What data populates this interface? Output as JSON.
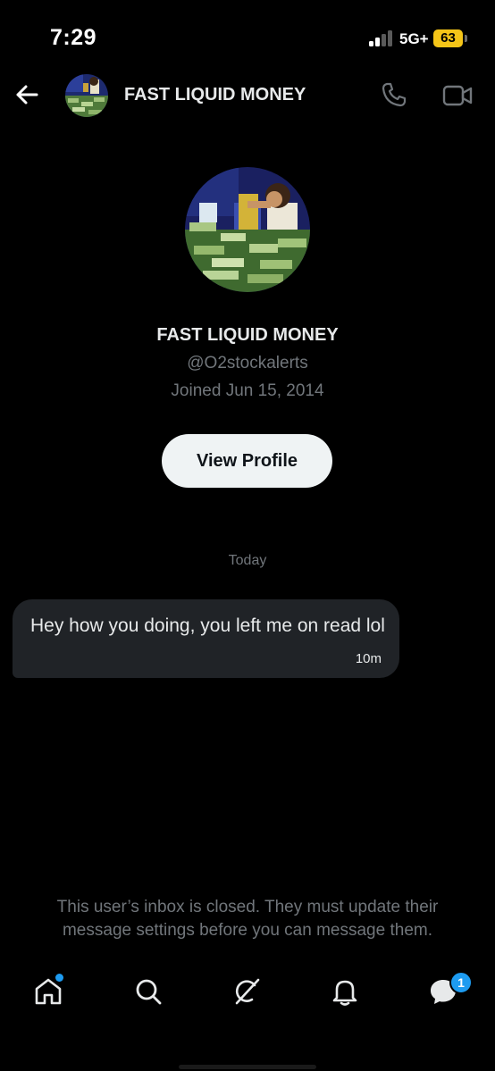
{
  "status": {
    "time": "7:29",
    "network": "5G+",
    "battery": "63"
  },
  "header": {
    "name": "FAST LIQUID MONEY",
    "back_icon": "arrow-left-icon",
    "call_icon": "phone-icon",
    "video_icon": "video-icon"
  },
  "profile": {
    "name": "FAST LIQUID MONEY",
    "handle": "@O2stockalerts",
    "joined": "Joined Jun 15, 2014",
    "view_profile_label": "View Profile"
  },
  "conversation": {
    "day_label": "Today",
    "messages": [
      {
        "text": "Hey how you doing, you left me on read lol",
        "time": "10m"
      }
    ]
  },
  "inbox_notice": "This user’s inbox is closed. They must update their message settings before you can message them.",
  "tabbar": {
    "items": [
      "home-icon",
      "search-icon",
      "grok-icon",
      "notifications-icon",
      "messages-icon"
    ],
    "messages_badge": "1"
  },
  "colors": {
    "accent": "#1d9bf0",
    "battery": "#f5c518",
    "bubble": "#202327",
    "muted": "#71767b"
  }
}
